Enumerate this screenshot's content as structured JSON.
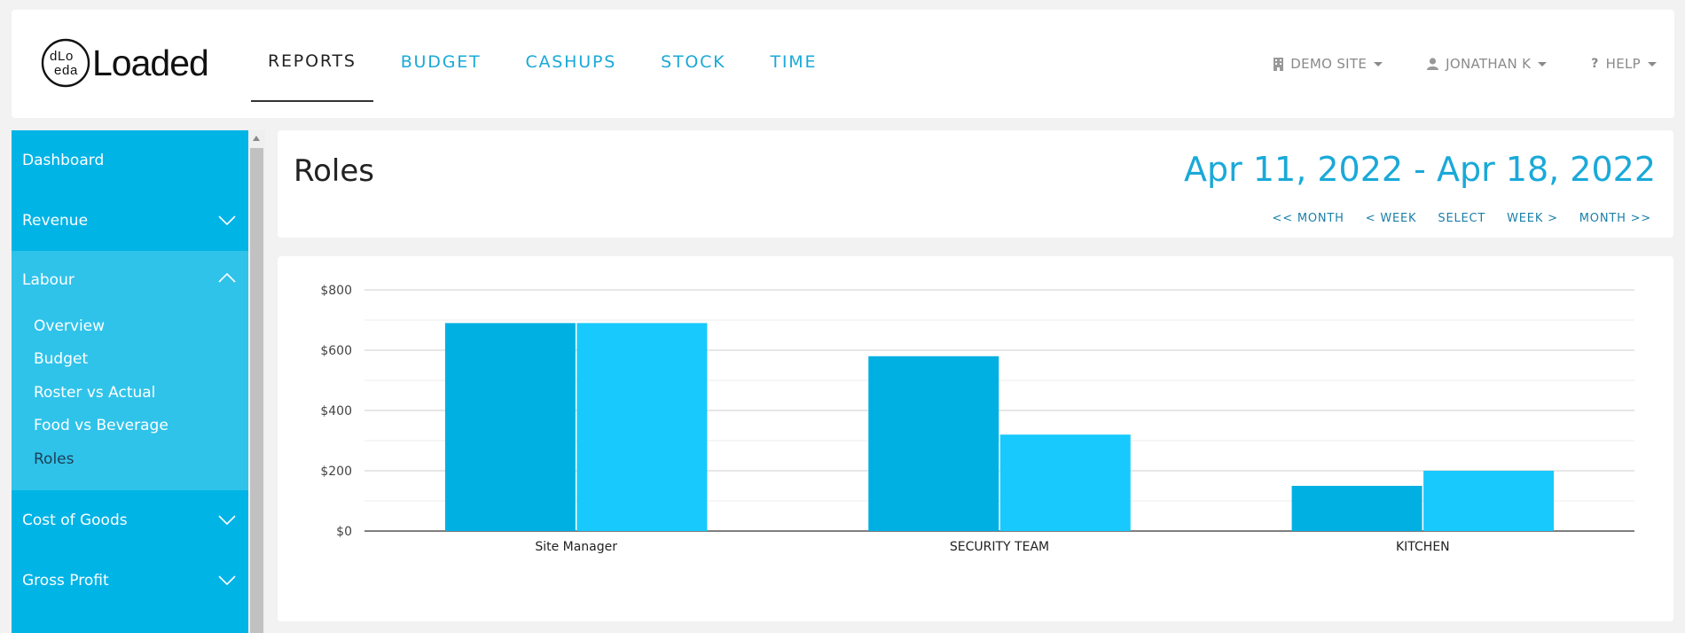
{
  "brand": {
    "name": "Loaded"
  },
  "nav": {
    "items": [
      {
        "label": "REPORTS",
        "active": true
      },
      {
        "label": "BUDGET",
        "active": false
      },
      {
        "label": "CASHUPS",
        "active": false
      },
      {
        "label": "STOCK",
        "active": false
      },
      {
        "label": "TIME",
        "active": false
      }
    ]
  },
  "user_menu": {
    "site": "DEMO SITE",
    "user": "JONATHAN K",
    "help": "HELP"
  },
  "sidebar": {
    "items": [
      {
        "label": "Dashboard"
      },
      {
        "label": "Revenue"
      },
      {
        "label": "Labour",
        "expanded": true,
        "children": [
          {
            "label": "Overview"
          },
          {
            "label": "Budget"
          },
          {
            "label": "Roster vs Actual"
          },
          {
            "label": "Food vs Beverage"
          },
          {
            "label": "Roles",
            "active": true
          }
        ]
      },
      {
        "label": "Cost of Goods"
      },
      {
        "label": "Gross Profit"
      }
    ]
  },
  "page": {
    "title": "Roles",
    "date_range": "Apr 11, 2022 - Apr 18, 2022",
    "date_nav": [
      "<< MONTH",
      "< WEEK",
      "SELECT",
      "WEEK >",
      "MONTH >>"
    ]
  },
  "colors": {
    "accent": "#1aa9d8",
    "sidebar_bg": "#00b4e6",
    "sidebar_group_bg": "#2fc3ea",
    "series_1": "#00b0e3",
    "series_2": "#18c9fd"
  },
  "chart_data": {
    "type": "bar",
    "categories": [
      "Site Manager",
      "SECURITY TEAM",
      "KITCHEN"
    ],
    "series": [
      {
        "values": [
          690,
          580,
          150
        ]
      },
      {
        "values": [
          690,
          320,
          200
        ]
      }
    ],
    "y_ticks": [
      "$0",
      "$200",
      "$400",
      "$600",
      "$800"
    ],
    "ylim": [
      0,
      800
    ],
    "grid": true
  }
}
